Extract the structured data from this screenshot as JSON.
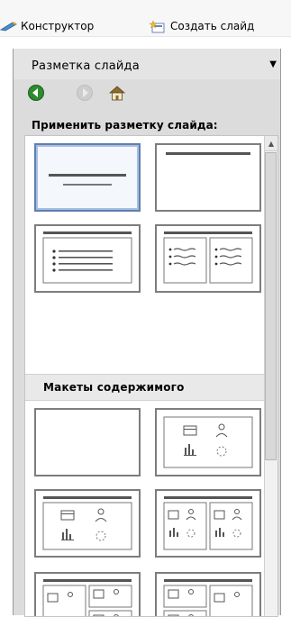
{
  "toolbar": {
    "design_label": "Конструктор",
    "new_slide_label": "Создать слайд"
  },
  "pane": {
    "title": "Разметка слайда",
    "apply_label": "Применить разметку слайда:",
    "content_section": "Макеты содержимого"
  },
  "colors": {
    "selected_border": "#5f7fb0",
    "back_button_green": "#2e8b2e",
    "thumb_border": "#7d7d7d"
  },
  "icons": {
    "design": "designer-icon",
    "new_slide": "new-slide-icon",
    "back": "back-arrow-icon",
    "forward": "forward-arrow-icon",
    "home": "home-icon",
    "menu": "chevron-down-icon"
  }
}
